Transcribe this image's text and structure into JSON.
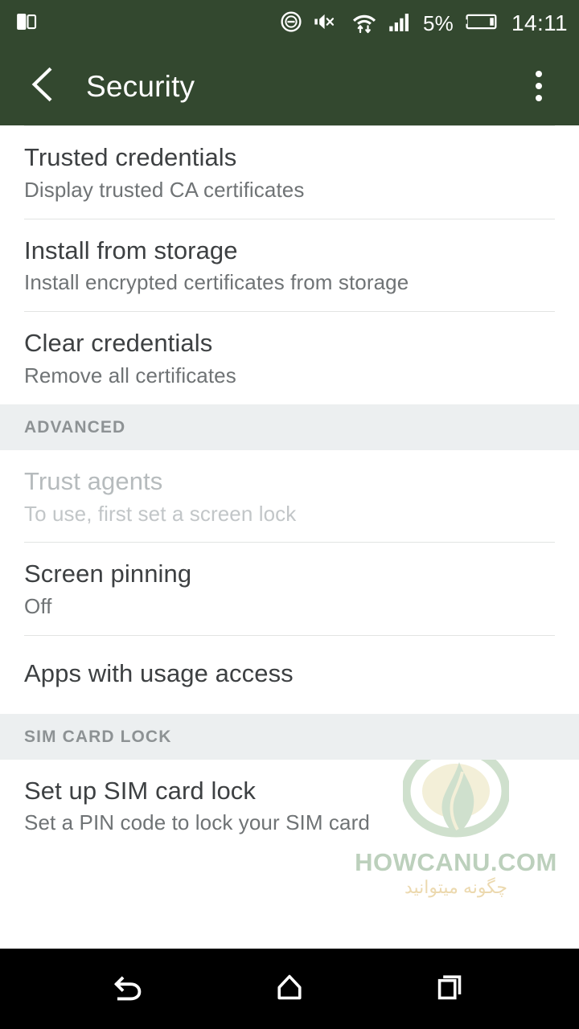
{
  "status_bar": {
    "background_color": "#33482f",
    "left_icons": [
      {
        "name": "screenshot-capture-icon"
      }
    ],
    "right_icons": [
      {
        "name": "do-not-disturb-icon"
      },
      {
        "name": "volume-muted-icon"
      },
      {
        "name": "wifi-transfer-icon"
      },
      {
        "name": "cellular-signal-icon"
      }
    ],
    "battery_percent": "5%",
    "battery_icon": "battery-low-icon",
    "clock": "14:11"
  },
  "action_bar": {
    "back_icon": "chevron-left-icon",
    "title": "Security",
    "overflow_icon": "overflow-menu-icon"
  },
  "list": [
    {
      "kind": "item",
      "name": "trusted-credentials",
      "title": "Trusted credentials",
      "subtitle": "Display trusted CA certificates",
      "disabled": false
    },
    {
      "kind": "item",
      "name": "install-from-storage",
      "title": "Install from storage",
      "subtitle": "Install encrypted certificates from storage",
      "disabled": false
    },
    {
      "kind": "item",
      "name": "clear-credentials",
      "title": "Clear credentials",
      "subtitle": "Remove all certificates",
      "disabled": false
    },
    {
      "kind": "section",
      "name": "section-advanced",
      "title": "ADVANCED"
    },
    {
      "kind": "item",
      "name": "trust-agents",
      "title": "Trust agents",
      "subtitle": "To use, first set a screen lock",
      "disabled": true
    },
    {
      "kind": "item",
      "name": "screen-pinning",
      "title": "Screen pinning",
      "subtitle": "Off",
      "disabled": false
    },
    {
      "kind": "item",
      "name": "apps-with-usage-access",
      "title": "Apps with usage access",
      "subtitle": "",
      "disabled": false
    },
    {
      "kind": "section",
      "name": "section-sim-card-lock",
      "title": "SIM CARD LOCK"
    },
    {
      "kind": "item",
      "name": "set-up-sim-card-lock",
      "title": "Set up SIM card lock",
      "subtitle": "Set a PIN code to lock your SIM card",
      "disabled": false
    }
  ],
  "watermark": {
    "logo_icon": "leaf-in-circle-logo",
    "brand": "HOWCANU.COM",
    "subtitle": "چگونه میتوانید",
    "brand_color": "#bcd0bc",
    "subtitle_color": "#ecd9af"
  },
  "nav_bar": {
    "background_color": "#000000",
    "buttons": [
      {
        "name": "nav-back-button",
        "icon": "back-arrow-icon"
      },
      {
        "name": "nav-home-button",
        "icon": "home-icon"
      },
      {
        "name": "nav-recents-button",
        "icon": "recent-apps-icon"
      }
    ]
  }
}
